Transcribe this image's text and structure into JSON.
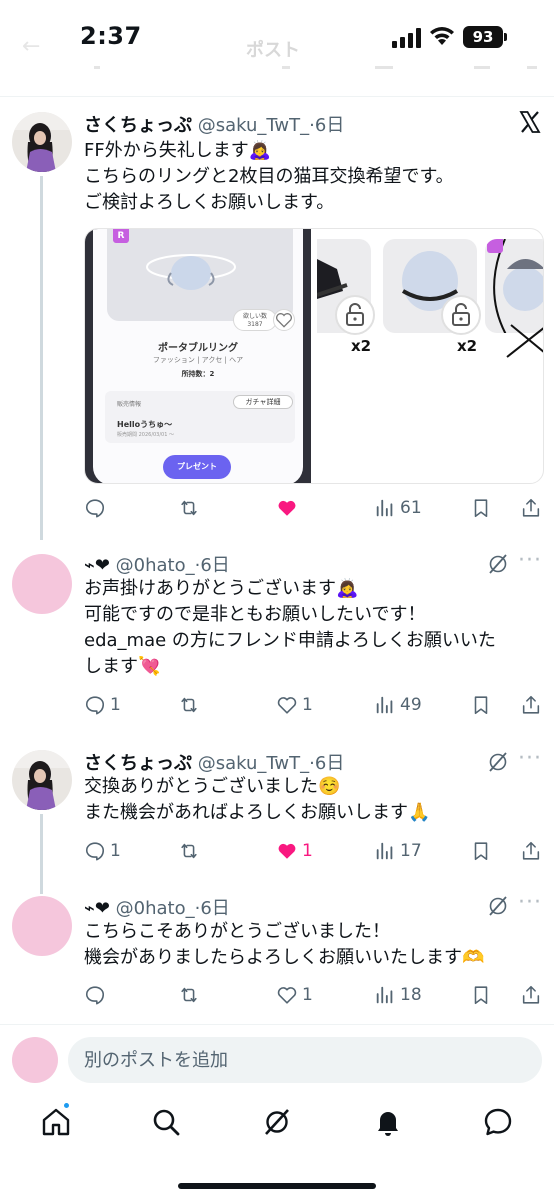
{
  "status_bar": {
    "time": "2:37",
    "battery": "93"
  },
  "nav": {
    "title": "ポスト"
  },
  "posts": [
    {
      "name": "さくちょっぷ",
      "handle": "@saku_TwT_",
      "time": "·6日",
      "lines": [
        "FF外から失礼します🙇‍♀️",
        "こちらのリングと2枚目の猫耳交換希望です。",
        "ご検討よろしくお願いします。"
      ],
      "replies": "",
      "reposts": "",
      "likes": "",
      "liked": true,
      "views": "61",
      "icon": "x-logo-icon"
    },
    {
      "name": "⌁❤",
      "handle": "@0hato_",
      "time": "·6日",
      "lines": [
        "お声掛けありがとうございます🙇‍♀️",
        "可能ですので是非ともお願いしたいです！",
        "eda_mae の方にフレンド申請よろしくお願いいた",
        "します💘"
      ],
      "replies": "1",
      "reposts": "",
      "likes": "1",
      "liked": false,
      "views": "49",
      "icon": "grok-icon"
    },
    {
      "name": "さくちょっぷ",
      "handle": "@saku_TwT_",
      "time": "·6日",
      "lines": [
        "交換ありがとうございました☺️",
        "また機会があればよろしくお願いします🙏"
      ],
      "replies": "1",
      "reposts": "",
      "likes": "1",
      "liked": true,
      "views": "17",
      "icon": "grok-icon"
    },
    {
      "name": "⌁❤",
      "handle": "@0hato_",
      "time": "·6日",
      "lines": [
        "こちらこそありがとうございました！",
        "機会がありましたらよろしくお願いいたします🫶"
      ],
      "replies": "",
      "reposts": "",
      "likes": "1",
      "liked": false,
      "views": "18",
      "icon": "grok-icon"
    }
  ],
  "media": {
    "item_name": "ポータブルリング",
    "category": "ファッション | アクセ | ヘア",
    "owned": "所持数：2",
    "want_label": "欲しい数",
    "want_count": "3187",
    "sales_label": "販売情報",
    "gacha_button": "ガチャ詳細",
    "seller": "Helloうちゅ〜",
    "period": "販売期間 2026/03/01 〜",
    "present_button": "プレゼント",
    "badge": "R",
    "tile_counts": [
      "x2",
      "x2"
    ]
  },
  "reply_bar": {
    "placeholder": "別のポストを追加"
  },
  "colors": {
    "like_active": "#f91880",
    "icon_gray": "#536471",
    "accent": "#1d9bf0",
    "avatar_pink": "#f5c6dc"
  },
  "tabs": [
    "home-icon",
    "search-icon",
    "grok-icon",
    "notifications-icon",
    "messages-icon"
  ]
}
